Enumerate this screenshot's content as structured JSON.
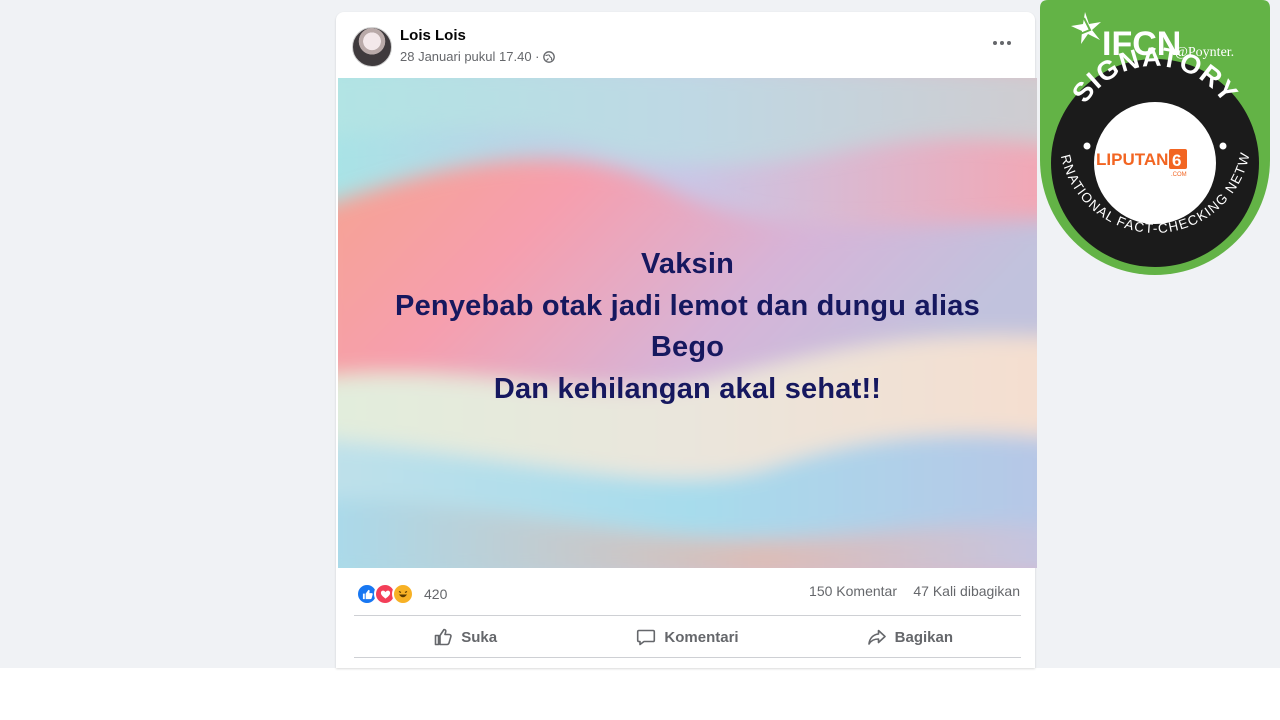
{
  "post": {
    "author": "Lois Lois",
    "timestamp": "28 Januari pukul 17.40 ·",
    "image_text": {
      "line1": "Vaksin",
      "line2": "Penyebab otak jadi lemot dan dungu alias",
      "line3": "Bego",
      "line4": "Dan kehilangan akal sehat!!"
    },
    "reaction_count": "420",
    "comments_count": "150 Komentar",
    "shares_count": "47 Kali dibagikan",
    "actions": {
      "like": "Suka",
      "comment": "Komentari",
      "share": "Bagikan"
    }
  },
  "badge": {
    "brand": "IFCN",
    "partner": "@Poynter.",
    "signatory": "SIGNATORY",
    "network": "INTERNATIONAL FACT-CHECKING NETWORK",
    "logo_text": "LIPUTAN",
    "logo_number": "6",
    "logo_sub": ".COM",
    "colors": {
      "green": "#63b346",
      "dark": "#1b1b1b",
      "logo_orange": "#f26522"
    }
  },
  "icons": {
    "more": "more-horizontal-icon",
    "privacy": "globe-icon",
    "like": "thumbs-up-icon",
    "comment": "comment-bubble-icon",
    "share": "share-arrow-icon"
  }
}
